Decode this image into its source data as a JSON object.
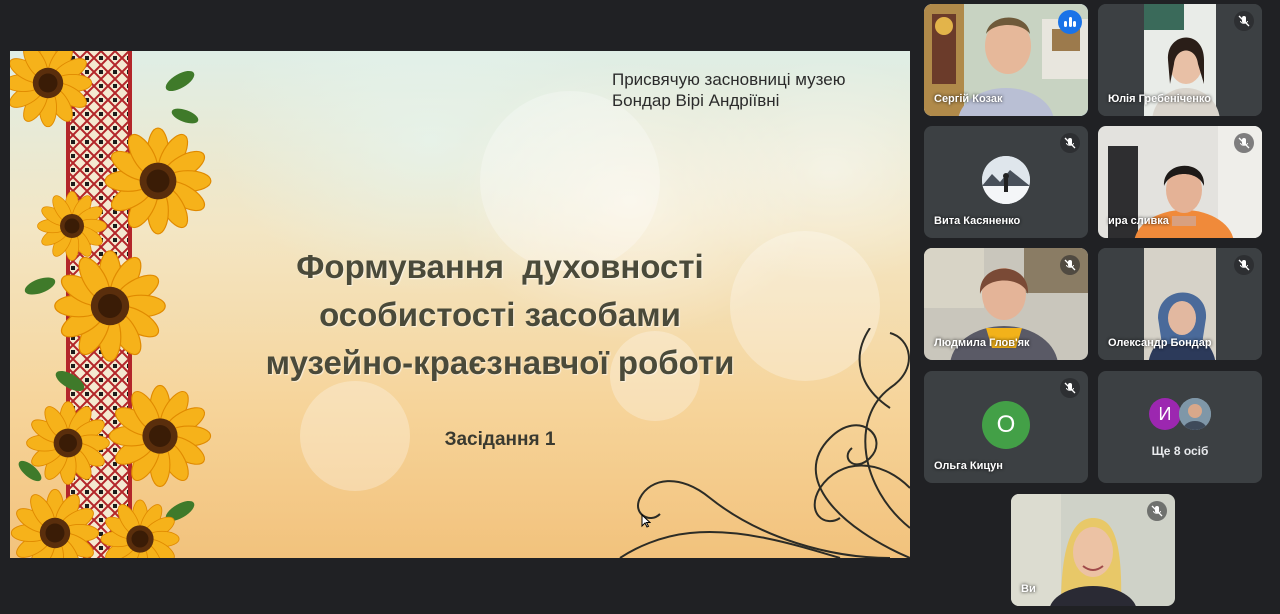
{
  "slide": {
    "dedication_line1": "Присвячую засновниці музею",
    "dedication_line2": "Бондар Вірі Андріївні",
    "title_line1": "Формування  духовності",
    "title_line2": "особистості засобами",
    "title_line3": "музейно-краєзнавчої роботи",
    "session": "Засідання 1"
  },
  "participants": [
    {
      "name": "Сергій Козак",
      "state": "speaking"
    },
    {
      "name": "Юлія Гребеніченко",
      "state": "muted"
    },
    {
      "name": "Вита Касяненко",
      "state": "muted"
    },
    {
      "name": "ира сливка",
      "state": "muted"
    },
    {
      "name": "Людмила Глов'як",
      "state": "muted"
    },
    {
      "name": "Олександр Бондар",
      "state": "muted"
    },
    {
      "name": "Ольга Кицун",
      "initial": "О",
      "state": "muted"
    },
    {
      "name": "Ви",
      "state": "muted"
    }
  ],
  "more": {
    "label": "Ще 8 осіб",
    "initial": "И"
  },
  "colors": {
    "background": "#202124",
    "tile": "#3c4043",
    "speaking_accent": "#1a73e8",
    "avatar_green": "#43a047",
    "avatar_purple": "#9c27b0"
  }
}
